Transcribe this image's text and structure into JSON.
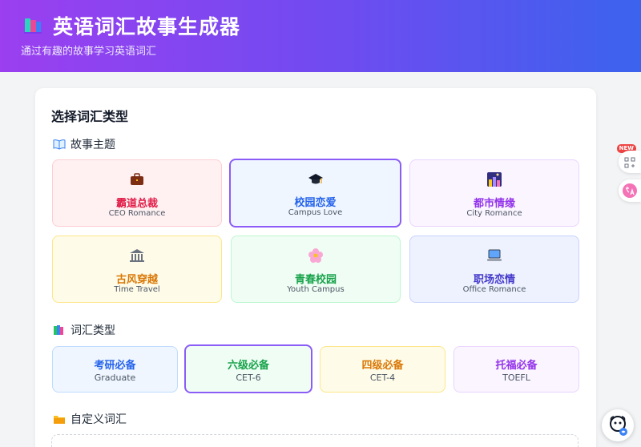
{
  "header": {
    "title": "英语词汇故事生成器",
    "subtitle": "通过有趣的故事学习英语词汇"
  },
  "card": {
    "title": "选择词汇类型",
    "theme_section": "故事主题",
    "vocab_section": "词汇类型",
    "custom_section": "自定义词汇"
  },
  "themes": [
    {
      "name": "霸道总裁",
      "en": "CEO Romance",
      "icon": "briefcase-icon",
      "color": "#e11d48",
      "selected": false
    },
    {
      "name": "校园恋爱",
      "en": "Campus Love",
      "icon": "graduation-cap-icon",
      "color": "#2563eb",
      "selected": true
    },
    {
      "name": "都市情缘",
      "en": "City Romance",
      "icon": "city-night-icon",
      "color": "#9333ea",
      "selected": false
    },
    {
      "name": "古风穿越",
      "en": "Time Travel",
      "icon": "classical-building-icon",
      "color": "#d97706",
      "selected": false
    },
    {
      "name": "青春校园",
      "en": "Youth Campus",
      "icon": "cherry-blossom-icon",
      "color": "#16a34a",
      "selected": false
    },
    {
      "name": "职场恋情",
      "en": "Office Romance",
      "icon": "laptop-icon",
      "color": "#4338ca",
      "selected": false
    }
  ],
  "vocab_types": [
    {
      "name": "考研必备",
      "en": "Graduate",
      "color": "#2563eb",
      "selected": false
    },
    {
      "name": "六级必备",
      "en": "CET-6",
      "color": "#16a34a",
      "selected": true
    },
    {
      "name": "四级必备",
      "en": "CET-4",
      "color": "#d97706",
      "selected": false
    },
    {
      "name": "托福必备",
      "en": "TOEFL",
      "color": "#9333ea",
      "selected": false
    }
  ],
  "floating": {
    "badge": "NEW"
  }
}
